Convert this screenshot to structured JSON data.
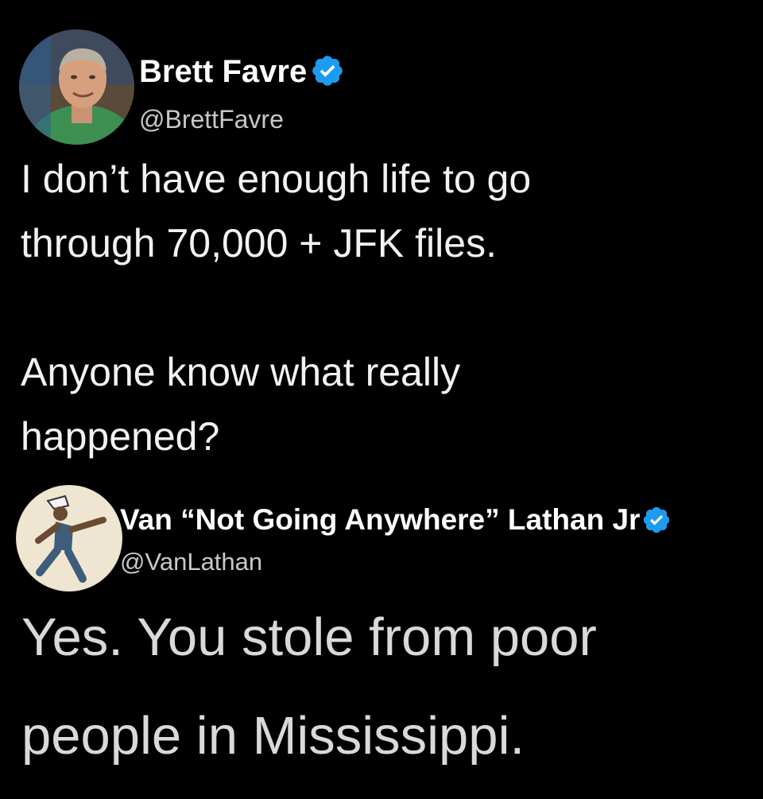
{
  "colors": {
    "background": "#000000",
    "text": "#ffffff",
    "handle": "#c8c8c8",
    "verified_badge": "#1d9bf0"
  },
  "tweets": [
    {
      "display_name": "Brett Favre",
      "verified": true,
      "handle": "@BrettFavre",
      "text": "I don’t have enough life to go\nthrough 70,000 + JFK files.\n\nAnyone know what really\nhappened?"
    },
    {
      "display_name": "Van “Not Going Anywhere” Lathan Jr",
      "verified": true,
      "handle": "@VanLathan",
      "text": "Yes. You stole from poor\npeople in Mississippi."
    }
  ]
}
